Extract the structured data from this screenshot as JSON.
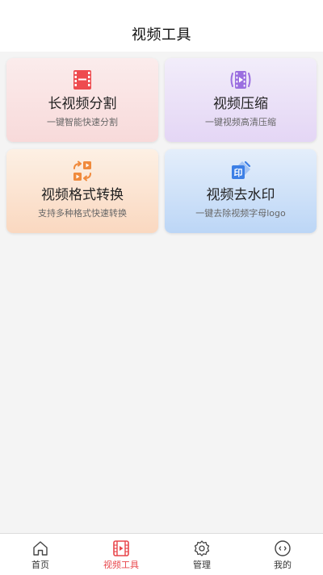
{
  "header": {
    "title": "视频工具"
  },
  "tools": [
    {
      "title": "长视频分割",
      "subtitle": "一键智能快速分割",
      "icon": "film-cut-icon"
    },
    {
      "title": "视频压缩",
      "subtitle": "一键视频高清压缩",
      "icon": "video-compress-icon"
    },
    {
      "title": "视频格式转换",
      "subtitle": "支持多种格式快速转换",
      "icon": "format-convert-icon"
    },
    {
      "title": "视频去水印",
      "subtitle": "一键去除视频字母logo",
      "icon": "remove-watermark-icon"
    }
  ],
  "tabbar": {
    "items": [
      {
        "label": "首页",
        "icon": "home-icon",
        "active": false
      },
      {
        "label": "视频工具",
        "icon": "film-icon",
        "active": true
      },
      {
        "label": "管理",
        "icon": "gear-icon",
        "active": false
      },
      {
        "label": "我的",
        "icon": "profile-icon",
        "active": false
      }
    ]
  },
  "colors": {
    "accent": "#e8474c",
    "compress_icon": "#9b6fe0",
    "convert_icon": "#f08a3c",
    "watermark_icon": "#3c7fe6"
  }
}
